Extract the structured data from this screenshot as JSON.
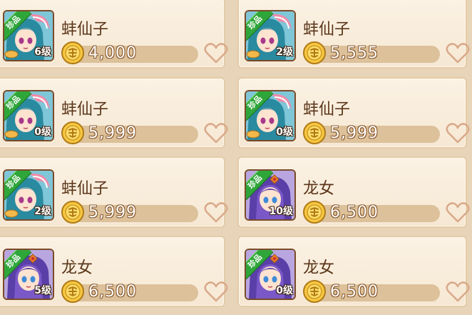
{
  "cards": [
    {
      "badge": "珍品",
      "name": "蚌仙子",
      "level": "6级",
      "price": "4,000",
      "character": "bang-xianzi"
    },
    {
      "badge": "珍品",
      "name": "蚌仙子",
      "level": "2级",
      "price": "5,555",
      "character": "bang-xianzi"
    },
    {
      "badge": "珍品",
      "name": "蚌仙子",
      "level": "0级",
      "price": "5,999",
      "character": "bang-xianzi"
    },
    {
      "badge": "珍品",
      "name": "蚌仙子",
      "level": "0级",
      "price": "5,999",
      "character": "bang-xianzi"
    },
    {
      "badge": "珍品",
      "name": "蚌仙子",
      "level": "2级",
      "price": "5,999",
      "character": "bang-xianzi"
    },
    {
      "badge": "珍品",
      "name": "龙女",
      "level": "10级",
      "price": "6,500",
      "character": "long-nv"
    },
    {
      "badge": "珍品",
      "name": "龙女",
      "level": "5级",
      "price": "6,500",
      "character": "long-nv"
    },
    {
      "badge": "珍品",
      "name": "龙女",
      "level": "0级",
      "price": "6,500",
      "character": "long-nv"
    }
  ],
  "icons": {
    "currency": "gold-coin-icon",
    "favorite": "heart-outline-icon"
  },
  "colors": {
    "badge": "#2fa63a",
    "card_border": "#e3cca8",
    "price_bar": "#dcc19a",
    "heart": "#d9a98a"
  }
}
